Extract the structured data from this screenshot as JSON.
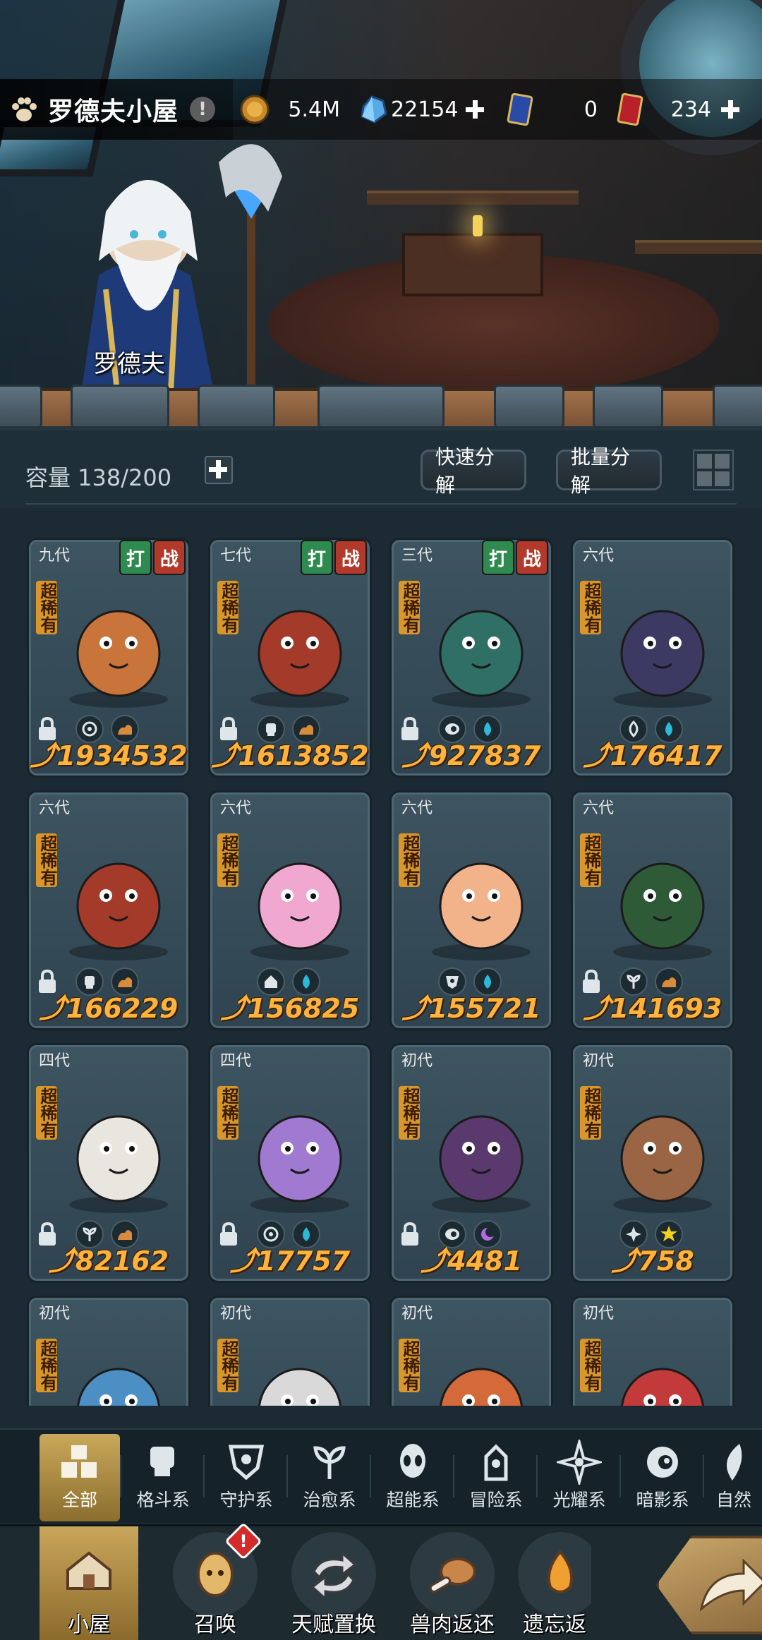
{
  "header": {
    "house_title": "罗德夫小屋",
    "info_icon": "!",
    "npc_name": "罗德夫"
  },
  "resources": [
    {
      "icon": "coin-icon",
      "value": "5.4M",
      "has_plus": false
    },
    {
      "icon": "crystal-icon",
      "value": "22154",
      "has_plus": true
    },
    {
      "icon": "blue-card-icon",
      "value": "0",
      "has_plus": false
    },
    {
      "icon": "red-card-icon",
      "value": "234",
      "has_plus": true
    }
  ],
  "controls": {
    "capacity": "容量 138/200",
    "quick_decompose": "快速分解",
    "batch_decompose": "批量分解"
  },
  "cards": [
    {
      "gen": "九代",
      "rarity": "超稀有",
      "tags": [
        "打",
        "战"
      ],
      "power": "1934532",
      "locked": true,
      "elems": [
        "fight",
        "land"
      ],
      "color": "#c8743a"
    },
    {
      "gen": "七代",
      "rarity": "超稀有",
      "tags": [
        "打",
        "战"
      ],
      "power": "1613852",
      "locked": true,
      "elems": [
        "fist",
        "land"
      ],
      "color": "#a33a2a"
    },
    {
      "gen": "三代",
      "rarity": "超稀有",
      "tags": [
        "打",
        "战"
      ],
      "power": "927837",
      "locked": true,
      "elems": [
        "eye",
        "water"
      ],
      "color": "#2f6f66"
    },
    {
      "gen": "六代",
      "rarity": "超稀有",
      "tags": [],
      "power": "176417",
      "locked": false,
      "elems": [
        "leaf",
        "water"
      ],
      "color": "#3c3a63"
    },
    {
      "gen": "六代",
      "rarity": "超稀有",
      "tags": [],
      "power": "166229",
      "locked": true,
      "elems": [
        "fist",
        "land"
      ],
      "color": "#a33a2a"
    },
    {
      "gen": "六代",
      "rarity": "超稀有",
      "tags": [],
      "power": "156825",
      "locked": false,
      "elems": [
        "house",
        "water"
      ],
      "color": "#f0a8d0"
    },
    {
      "gen": "六代",
      "rarity": "超稀有",
      "tags": [],
      "power": "155721",
      "locked": false,
      "elems": [
        "shield",
        "water"
      ],
      "color": "#f2b38a"
    },
    {
      "gen": "六代",
      "rarity": "超稀有",
      "tags": [],
      "power": "141693",
      "locked": true,
      "elems": [
        "sprout",
        "land"
      ],
      "color": "#2f5a38"
    },
    {
      "gen": "四代",
      "rarity": "超稀有",
      "tags": [],
      "power": "82162",
      "locked": true,
      "elems": [
        "sprout",
        "land"
      ],
      "color": "#e8e6df"
    },
    {
      "gen": "四代",
      "rarity": "超稀有",
      "tags": [],
      "power": "17757",
      "locked": true,
      "elems": [
        "fight",
        "water"
      ],
      "color": "#a07ad0"
    },
    {
      "gen": "初代",
      "rarity": "超稀有",
      "tags": [],
      "power": "4481",
      "locked": true,
      "elems": [
        "eye",
        "moon"
      ],
      "color": "#5a3a6e"
    },
    {
      "gen": "初代",
      "rarity": "超稀有",
      "tags": [],
      "power": "758",
      "locked": false,
      "elems": [
        "star",
        "sun"
      ],
      "color": "#9a6544"
    },
    {
      "gen": "初代",
      "rarity": "超稀有",
      "tags": [],
      "power": "",
      "locked": false,
      "elems": [],
      "color": "#4b8fc4"
    },
    {
      "gen": "初代",
      "rarity": "超稀有",
      "tags": [],
      "power": "",
      "locked": false,
      "elems": [],
      "color": "#d9d9d9"
    },
    {
      "gen": "初代",
      "rarity": "超稀有",
      "tags": [],
      "power": "",
      "locked": false,
      "elems": [],
      "color": "#d46a3a"
    },
    {
      "gen": "初代",
      "rarity": "超稀有",
      "tags": [],
      "power": "",
      "locked": false,
      "elems": [],
      "color": "#c23a3a"
    }
  ],
  "filters": [
    {
      "label": "全部",
      "icon": "all-blocks-icon",
      "active": true
    },
    {
      "label": "格斗系",
      "icon": "fist-icon",
      "active": false
    },
    {
      "label": "守护系",
      "icon": "shield-icon",
      "active": false
    },
    {
      "label": "治愈系",
      "icon": "sprout-icon",
      "active": false
    },
    {
      "label": "超能系",
      "icon": "alien-icon",
      "active": false
    },
    {
      "label": "冒险系",
      "icon": "tower-icon",
      "active": false
    },
    {
      "label": "光耀系",
      "icon": "shine-icon",
      "active": false
    },
    {
      "label": "暗影系",
      "icon": "eye-icon",
      "active": false
    },
    {
      "label": "自然",
      "icon": "leaf-icon",
      "active": false
    }
  ],
  "nav": [
    {
      "label": "小屋",
      "icon": "house-icon",
      "active": true
    },
    {
      "label": "召唤",
      "icon": "egg-icon",
      "active": false
    },
    {
      "label": "天赋置换",
      "icon": "swap-icon",
      "active": false
    },
    {
      "label": "兽肉返还",
      "icon": "meat-icon",
      "active": false
    },
    {
      "label": "遗忘返",
      "icon": "fire-icon",
      "active": false
    }
  ],
  "badge": "!",
  "colors": {
    "accent_gold": "#c9a95a",
    "power_orange": "#ffb23c",
    "rarity_orange": "#d9962a",
    "tag_green": "#2e8a4e",
    "tag_red": "#b23a2a"
  }
}
